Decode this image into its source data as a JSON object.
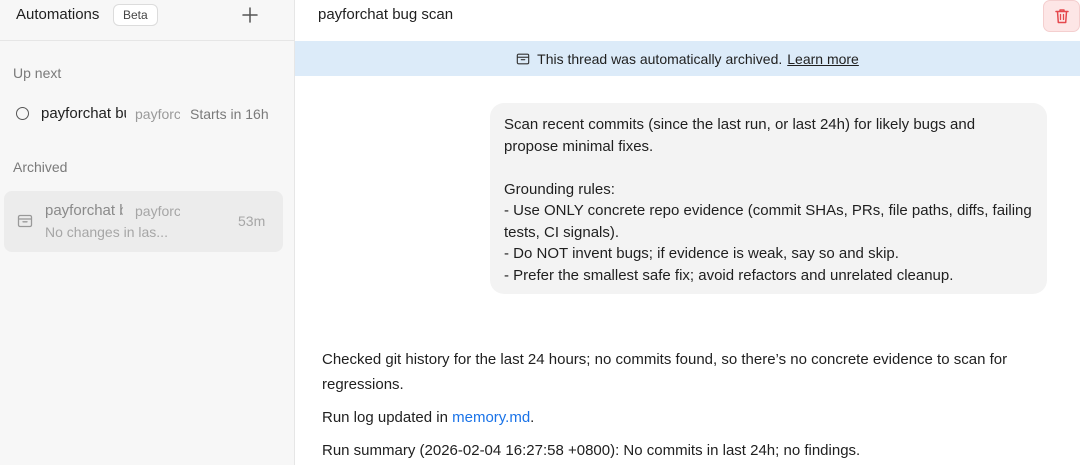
{
  "sidebar": {
    "title": "Automations",
    "beta_badge": "Beta",
    "sections": {
      "up_next": {
        "label": "Up next",
        "item": {
          "name": "payforchat bug scan",
          "subtitle": "payforchat",
          "status": "Starts in 16h"
        }
      },
      "archived": {
        "label": "Archived",
        "item": {
          "name": "payforchat bug scan",
          "subtitle": "payforchat",
          "preview": "No changes in las...",
          "time": "53m"
        }
      }
    }
  },
  "main": {
    "title": "payforchat bug scan",
    "banner": {
      "text": "This thread was automatically archived.",
      "link": "Learn more"
    },
    "user_message": {
      "text": "Scan recent commits (since the last run, or last 24h) for likely bugs and propose minimal fixes.\n\nGrounding rules:\n- Use ONLY concrete repo evidence (commit SHAs, PRs, file paths, diffs, failing tests, CI signals).\n- Do NOT invent bugs; if evidence is weak, say so and skip.\n- Prefer the smallest safe fix; avoid refactors and unrelated cleanup."
    },
    "response": {
      "p1": "Checked git history for the last 24 hours; no commits found, so there’s no concrete evidence to scan for regressions.",
      "p2_prefix": "Run log updated in ",
      "p2_link": "memory.md",
      "p2_suffix": ".",
      "p3": "Run summary (2026-02-04 16:27:58 +0800): No commits in last 24h; no findings."
    }
  },
  "icons": {
    "plus": "plus-icon",
    "circle": "circle-icon",
    "archive": "archive-icon",
    "trash": "trash-icon"
  },
  "colors": {
    "banner_bg": "#dcebf9",
    "link": "#1a73e8",
    "delete_accent": "#e5484d"
  }
}
